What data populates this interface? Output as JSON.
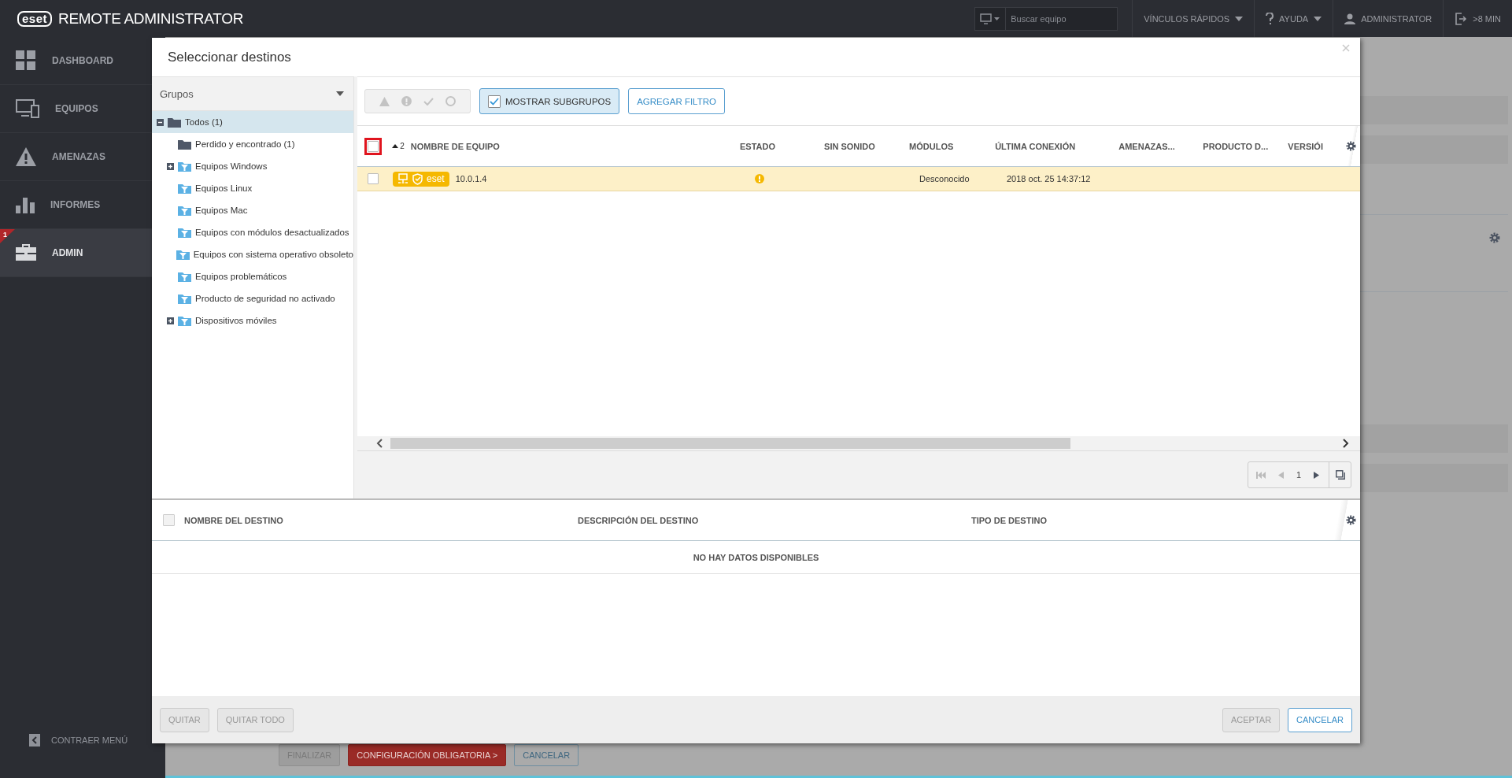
{
  "app": {
    "logo": "eset",
    "title": "REMOTE ADMINISTRATOR"
  },
  "topbar": {
    "search_placeholder": "Buscar equipo",
    "links": [
      {
        "label": "VÍNCULOS RÁPIDOS",
        "kind": "quicklinks"
      },
      {
        "label": "AYUDA",
        "kind": "help"
      },
      {
        "label": "ADMINISTRATOR",
        "kind": "user"
      },
      {
        "label": ">8 MIN",
        "kind": "logout"
      }
    ]
  },
  "sidebar": {
    "items": [
      {
        "label": "DASHBOARD",
        "kind": "dashboard",
        "selected": false
      },
      {
        "label": "EQUIPOS",
        "kind": "computers",
        "selected": false
      },
      {
        "label": "AMENAZAS",
        "kind": "threats",
        "selected": false
      },
      {
        "label": "INFORMES",
        "kind": "reports",
        "selected": false
      },
      {
        "label": "ADMIN",
        "kind": "admin",
        "selected": true,
        "badge": "1"
      }
    ],
    "collapse": "CONTRAER MENÚ"
  },
  "page": {
    "buttons": [
      {
        "label": "FINALIZAR",
        "kind": "disabled"
      },
      {
        "label": "CONFIGURACIÓN OBLIGATORIA >",
        "kind": "primary"
      },
      {
        "label": "CANCELAR",
        "kind": "secondary"
      }
    ]
  },
  "dialog": {
    "title": "Seleccionar destinos",
    "groups": {
      "title": "Grupos",
      "tree": [
        {
          "label": "Todos (1)",
          "kind": "folder",
          "expanded": true,
          "selected": true,
          "children": [
            {
              "label": "Perdido y encontrado (1)",
              "kind": "folder",
              "selected": false
            },
            {
              "label": "Equipos Windows",
              "kind": "filter",
              "expanded": false,
              "selected": false
            },
            {
              "label": "Equipos Linux",
              "kind": "filter",
              "selected": false
            },
            {
              "label": "Equipos Mac",
              "kind": "filter",
              "selected": false
            },
            {
              "label": "Equipos con módulos desactualizados",
              "kind": "filter",
              "selected": false
            },
            {
              "label": "Equipos con sistema operativo obsoleto",
              "kind": "filter",
              "selected": false
            },
            {
              "label": "Equipos problemáticos",
              "kind": "filter",
              "selected": false
            },
            {
              "label": "Producto de seguridad no activado",
              "kind": "filter",
              "selected": false
            },
            {
              "label": "Dispositivos móviles",
              "kind": "filter",
              "expanded": false,
              "selected": false
            }
          ]
        }
      ]
    },
    "computers": {
      "show_subgroups": {
        "label": "MOSTRAR SUBGRUPOS",
        "checked": true
      },
      "add_filter": "AGREGAR FILTRO",
      "header_checkbox": {
        "checked": false,
        "highlighted": true
      },
      "columns": [
        {
          "label": "NOMBRE DE EQUIPO",
          "sort_order": "2"
        },
        {
          "label": "ESTADO"
        },
        {
          "label": "SIN SONIDO"
        },
        {
          "label": "MÓDULOS"
        },
        {
          "label": "ÚLTIMA CONEXIÓN"
        },
        {
          "label": "AMENAZAS..."
        },
        {
          "label": "PRODUCTO D..."
        },
        {
          "label": "VERSIÓI"
        }
      ],
      "rows": [
        {
          "checked": false,
          "badge": "eset",
          "name": "10.0.1.4",
          "warning": true,
          "modules": "Desconocido",
          "last_connection": "2018 oct. 25 14:37:12"
        }
      ],
      "page": "1"
    },
    "targets": {
      "header_checkbox": {
        "checked": false
      },
      "columns": [
        "NOMBRE DEL DESTINO",
        "DESCRIPCIÓN DEL DESTINO",
        "TIPO DE DESTINO"
      ],
      "empty_text": "NO HAY DATOS DISPONIBLES"
    },
    "footer": {
      "left": [
        {
          "label": "QUITAR",
          "disabled": true
        },
        {
          "label": "QUITAR TODO",
          "disabled": true
        }
      ],
      "right": [
        {
          "label": "ACEPTAR",
          "disabled": true
        },
        {
          "label": "CANCELAR",
          "disabled": false
        }
      ]
    }
  }
}
